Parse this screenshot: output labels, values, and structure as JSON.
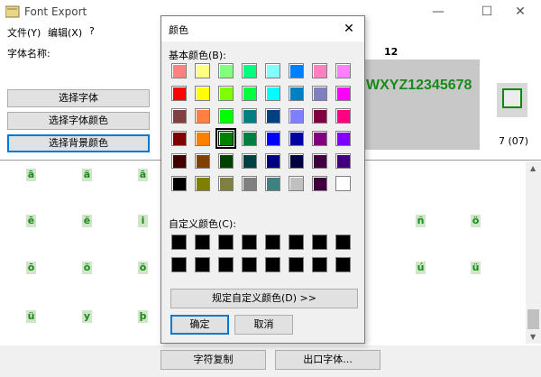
{
  "window": {
    "title": "Font Export",
    "controls": {
      "minimize": "—",
      "maximize": "☐",
      "close": "✕"
    }
  },
  "menu": [
    "文件(Y)",
    "编辑(X)",
    "?"
  ],
  "left_panel": {
    "font_name_label": "字体名称:",
    "buttons": [
      "选择字体",
      "选择字体颜色",
      "选择背景颜色"
    ]
  },
  "preview": {
    "text": "WXYZ12345678",
    "size_label": "12",
    "color_index": "7 (07)",
    "preview_color": "#1a8a1a",
    "preview_bg": "#c8c8c8"
  },
  "glyph_grid": {
    "rows": [
      [
        "ā",
        "ä",
        "ā",
        "",
        "",
        "",
        "",
        "",
        "",
        ""
      ],
      [
        "ē",
        "ë",
        "i",
        "",
        "",
        "",
        "",
        "ñ",
        "ö",
        ""
      ],
      [
        "ō",
        "ö",
        "ö",
        "",
        "",
        "",
        "",
        "ú",
        "ü",
        ""
      ],
      [
        "ü",
        "y",
        "þ",
        "",
        "",
        "",
        "",
        "",
        "",
        ""
      ]
    ],
    "glyph_color": "#1b8a1b",
    "glyph_bg": "#cfe7c8"
  },
  "bottom_buttons": [
    "字符复制",
    "出口字体..."
  ],
  "color_dialog": {
    "title": "颜色",
    "close": "✕",
    "basic_label": "基本颜色(B):",
    "basic_colors": [
      [
        "#ff8080",
        "#ffff80",
        "#80ff80",
        "#00ff80",
        "#80ffff",
        "#0080ff",
        "#ff80c0",
        "#ff80ff"
      ],
      [
        "#ff0000",
        "#ffff00",
        "#80ff00",
        "#00ff40",
        "#00ffff",
        "#0080c0",
        "#8080c0",
        "#ff00ff"
      ],
      [
        "#804040",
        "#ff8040",
        "#00ff00",
        "#008080",
        "#004080",
        "#8080ff",
        "#800040",
        "#ff0080"
      ],
      [
        "#800000",
        "#ff8000",
        "#008000",
        "#008040",
        "#0000ff",
        "#0000a0",
        "#800080",
        "#8000ff"
      ],
      [
        "#400000",
        "#804000",
        "#004000",
        "#004040",
        "#000080",
        "#000040",
        "#400040",
        "#400080"
      ],
      [
        "#000000",
        "#808000",
        "#808040",
        "#808080",
        "#408080",
        "#c0c0c0",
        "#400040",
        "#ffffff"
      ]
    ],
    "selected_color": {
      "row": 3,
      "col": 2
    },
    "custom_label": "自定义颜色(C):",
    "custom_colors": [
      [
        "#000000",
        "#000000",
        "#000000",
        "#000000",
        "#000000",
        "#000000",
        "#000000",
        "#000000"
      ],
      [
        "#000000",
        "#000000",
        "#000000",
        "#000000",
        "#000000",
        "#000000",
        "#000000",
        "#000000"
      ]
    ],
    "define_button": "规定自定义颜色(D) >>",
    "ok_button": "确定",
    "cancel_button": "取消"
  }
}
